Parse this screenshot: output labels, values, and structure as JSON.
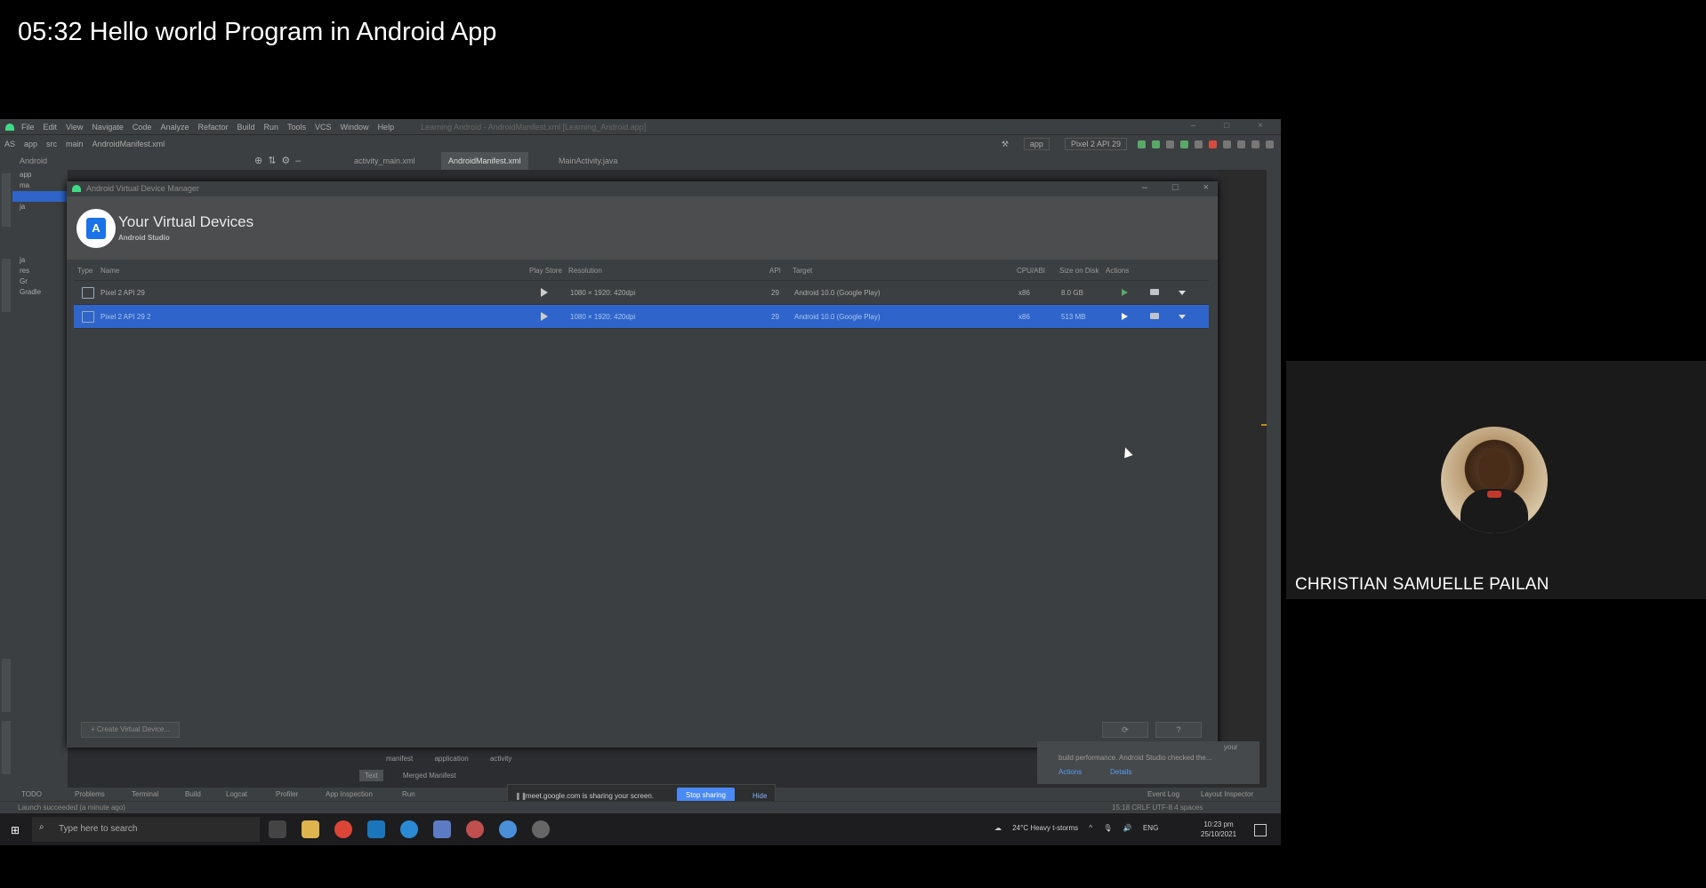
{
  "video": {
    "title": "05:32 Hello world Program in Android App"
  },
  "ide": {
    "menu": [
      "File",
      "Edit",
      "View",
      "Navigate",
      "Code",
      "Analyze",
      "Refactor",
      "Build",
      "Run",
      "Tools",
      "VCS",
      "Window",
      "Help"
    ],
    "window_title": "Learning Android - AndroidManifest.xml [Learning_Android.app]",
    "breadcrumb": [
      "AS",
      "app",
      "src",
      "main",
      "AndroidManifest.xml"
    ],
    "run_config": "app",
    "device_selector": "Pixel 2 API 29",
    "project_view": "Android",
    "tree": [
      "app",
      "ma",
      "",
      "ja",
      "",
      "",
      "",
      "",
      "ja",
      "res",
      "Gr",
      "Gradle"
    ],
    "tabs": [
      "activity_main.xml",
      "AndroidManifest.xml",
      "MainActivity.java"
    ],
    "editor_tags": [
      "manifest",
      "application",
      "activity"
    ],
    "editor_subtabs": [
      "Text",
      "Merged Manifest"
    ],
    "bottom_tools": [
      "TODO",
      "Problems",
      "Terminal",
      "Build",
      "Logcat",
      "Profiler",
      "App Inspection",
      "Run",
      "Event Log",
      "Layout Inspector"
    ],
    "status_left": "Launch succeeded (a minute ago)",
    "status_right": "15:18  CRLF  UTF-8  4 spaces",
    "notification": {
      "line1": "your",
      "line2": "build performance. Android Studio checked the...",
      "actions": "Actions",
      "details": "Details"
    }
  },
  "avd": {
    "window_title": "Android Virtual Device Manager",
    "header_title": "Your Virtual Devices",
    "header_subtitle": "Android Studio",
    "columns": [
      "Type",
      "Name",
      "Play Store",
      "Resolution",
      "API",
      "Target",
      "CPU/ABI",
      "Size on Disk",
      "Actions"
    ],
    "devices": [
      {
        "name": "Pixel 2 API 29",
        "resolution": "1080 × 1920: 420dpi",
        "api": "29",
        "target": "Android 10.0 (Google Play)",
        "cpu": "x86",
        "size": "8.0 GB",
        "selected": false
      },
      {
        "name": "Pixel 2 API 29 2",
        "resolution": "1080 × 1920: 420dpi",
        "api": "29",
        "target": "Android 10.0 (Google Play)",
        "cpu": "x86",
        "size": "513 MB",
        "selected": true
      }
    ],
    "create_button": "+ Create Virtual Device...",
    "refresh_button": "⟳",
    "help_button": "?"
  },
  "share_banner": {
    "text": "meet.google.com is sharing your screen.",
    "stop": "Stop sharing",
    "hide": "Hide"
  },
  "taskbar": {
    "search_placeholder": "Type here to search",
    "weather": "24°C  Heavy t-storms",
    "lang": "ENG",
    "time": "10:23 pm",
    "date": "25/10/2021"
  },
  "participant": {
    "name": "CHRISTIAN SAMUELLE PAILAN"
  },
  "colors": {
    "selection": "#2f65ca",
    "ide_bg": "#3c3f41",
    "android_green": "#3ddc84"
  }
}
